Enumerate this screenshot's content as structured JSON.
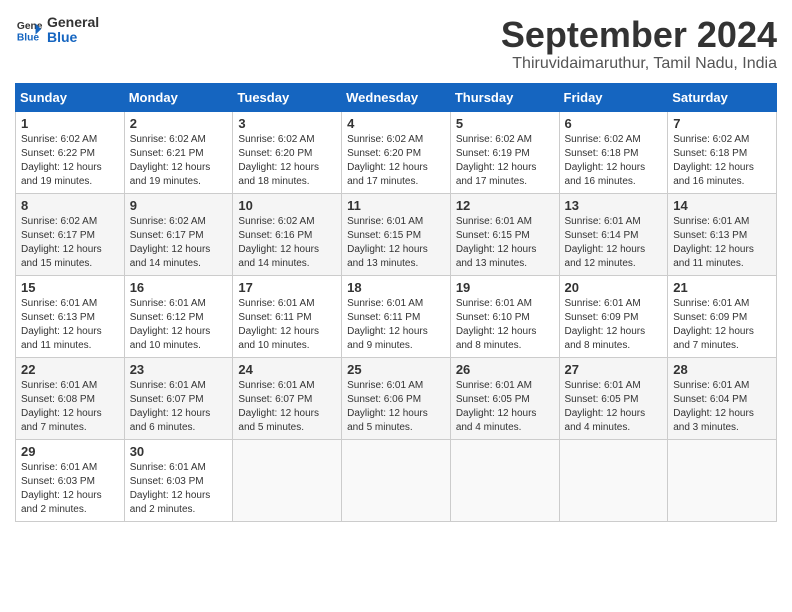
{
  "header": {
    "logo_line1": "General",
    "logo_line2": "Blue",
    "month": "September 2024",
    "location": "Thiruvidaimaruthur, Tamil Nadu, India"
  },
  "weekdays": [
    "Sunday",
    "Monday",
    "Tuesday",
    "Wednesday",
    "Thursday",
    "Friday",
    "Saturday"
  ],
  "weeks": [
    [
      {
        "day": "1",
        "sunrise": "6:02 AM",
        "sunset": "6:22 PM",
        "daylight": "12 hours and 19 minutes."
      },
      {
        "day": "2",
        "sunrise": "6:02 AM",
        "sunset": "6:21 PM",
        "daylight": "12 hours and 19 minutes."
      },
      {
        "day": "3",
        "sunrise": "6:02 AM",
        "sunset": "6:20 PM",
        "daylight": "12 hours and 18 minutes."
      },
      {
        "day": "4",
        "sunrise": "6:02 AM",
        "sunset": "6:20 PM",
        "daylight": "12 hours and 17 minutes."
      },
      {
        "day": "5",
        "sunrise": "6:02 AM",
        "sunset": "6:19 PM",
        "daylight": "12 hours and 17 minutes."
      },
      {
        "day": "6",
        "sunrise": "6:02 AM",
        "sunset": "6:18 PM",
        "daylight": "12 hours and 16 minutes."
      },
      {
        "day": "7",
        "sunrise": "6:02 AM",
        "sunset": "6:18 PM",
        "daylight": "12 hours and 16 minutes."
      }
    ],
    [
      {
        "day": "8",
        "sunrise": "6:02 AM",
        "sunset": "6:17 PM",
        "daylight": "12 hours and 15 minutes."
      },
      {
        "day": "9",
        "sunrise": "6:02 AM",
        "sunset": "6:17 PM",
        "daylight": "12 hours and 14 minutes."
      },
      {
        "day": "10",
        "sunrise": "6:02 AM",
        "sunset": "6:16 PM",
        "daylight": "12 hours and 14 minutes."
      },
      {
        "day": "11",
        "sunrise": "6:01 AM",
        "sunset": "6:15 PM",
        "daylight": "12 hours and 13 minutes."
      },
      {
        "day": "12",
        "sunrise": "6:01 AM",
        "sunset": "6:15 PM",
        "daylight": "12 hours and 13 minutes."
      },
      {
        "day": "13",
        "sunrise": "6:01 AM",
        "sunset": "6:14 PM",
        "daylight": "12 hours and 12 minutes."
      },
      {
        "day": "14",
        "sunrise": "6:01 AM",
        "sunset": "6:13 PM",
        "daylight": "12 hours and 11 minutes."
      }
    ],
    [
      {
        "day": "15",
        "sunrise": "6:01 AM",
        "sunset": "6:13 PM",
        "daylight": "12 hours and 11 minutes."
      },
      {
        "day": "16",
        "sunrise": "6:01 AM",
        "sunset": "6:12 PM",
        "daylight": "12 hours and 10 minutes."
      },
      {
        "day": "17",
        "sunrise": "6:01 AM",
        "sunset": "6:11 PM",
        "daylight": "12 hours and 10 minutes."
      },
      {
        "day": "18",
        "sunrise": "6:01 AM",
        "sunset": "6:11 PM",
        "daylight": "12 hours and 9 minutes."
      },
      {
        "day": "19",
        "sunrise": "6:01 AM",
        "sunset": "6:10 PM",
        "daylight": "12 hours and 8 minutes."
      },
      {
        "day": "20",
        "sunrise": "6:01 AM",
        "sunset": "6:09 PM",
        "daylight": "12 hours and 8 minutes."
      },
      {
        "day": "21",
        "sunrise": "6:01 AM",
        "sunset": "6:09 PM",
        "daylight": "12 hours and 7 minutes."
      }
    ],
    [
      {
        "day": "22",
        "sunrise": "6:01 AM",
        "sunset": "6:08 PM",
        "daylight": "12 hours and 7 minutes."
      },
      {
        "day": "23",
        "sunrise": "6:01 AM",
        "sunset": "6:07 PM",
        "daylight": "12 hours and 6 minutes."
      },
      {
        "day": "24",
        "sunrise": "6:01 AM",
        "sunset": "6:07 PM",
        "daylight": "12 hours and 5 minutes."
      },
      {
        "day": "25",
        "sunrise": "6:01 AM",
        "sunset": "6:06 PM",
        "daylight": "12 hours and 5 minutes."
      },
      {
        "day": "26",
        "sunrise": "6:01 AM",
        "sunset": "6:05 PM",
        "daylight": "12 hours and 4 minutes."
      },
      {
        "day": "27",
        "sunrise": "6:01 AM",
        "sunset": "6:05 PM",
        "daylight": "12 hours and 4 minutes."
      },
      {
        "day": "28",
        "sunrise": "6:01 AM",
        "sunset": "6:04 PM",
        "daylight": "12 hours and 3 minutes."
      }
    ],
    [
      {
        "day": "29",
        "sunrise": "6:01 AM",
        "sunset": "6:03 PM",
        "daylight": "12 hours and 2 minutes."
      },
      {
        "day": "30",
        "sunrise": "6:01 AM",
        "sunset": "6:03 PM",
        "daylight": "12 hours and 2 minutes."
      },
      null,
      null,
      null,
      null,
      null
    ]
  ],
  "labels": {
    "sunrise": "Sunrise:",
    "sunset": "Sunset:",
    "daylight": "Daylight:"
  }
}
